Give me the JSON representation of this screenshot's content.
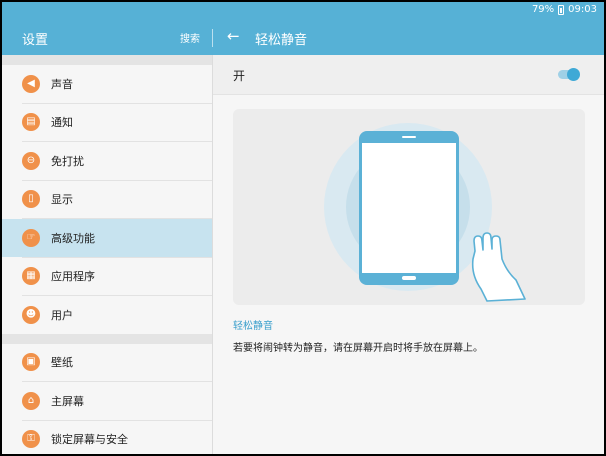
{
  "status": {
    "battery": "79%",
    "time": "09:03"
  },
  "appbar": {
    "title": "设置",
    "search_label": "搜索",
    "detail_title": "轻松静音"
  },
  "sidebar": {
    "groups": [
      [
        {
          "label": "声音",
          "icon": "speaker-icon",
          "active": false
        },
        {
          "label": "通知",
          "icon": "notification-icon",
          "active": false
        },
        {
          "label": "免打扰",
          "icon": "do-not-disturb-icon",
          "active": false
        },
        {
          "label": "显示",
          "icon": "display-icon",
          "active": false
        },
        {
          "label": "高级功能",
          "icon": "advanced-features-icon",
          "active": true
        },
        {
          "label": "应用程序",
          "icon": "apps-icon",
          "active": false
        },
        {
          "label": "用户",
          "icon": "users-icon",
          "active": false
        }
      ],
      [
        {
          "label": "壁纸",
          "icon": "wallpaper-icon",
          "active": false
        },
        {
          "label": "主屏幕",
          "icon": "home-icon",
          "active": false
        },
        {
          "label": "锁定屏幕与安全",
          "icon": "lock-icon",
          "active": false
        }
      ]
    ]
  },
  "toggle": {
    "label": "开",
    "enabled": true
  },
  "section": {
    "title": "轻松静音",
    "description": "若要将闹钟转为静音，请在屏幕开启时将手放在屏幕上。"
  },
  "colors": {
    "accent": "#56b1d6",
    "icon_bg": "#f0914a",
    "active_bg": "#c7e3ef",
    "switch_on": "#3fa9d6"
  }
}
